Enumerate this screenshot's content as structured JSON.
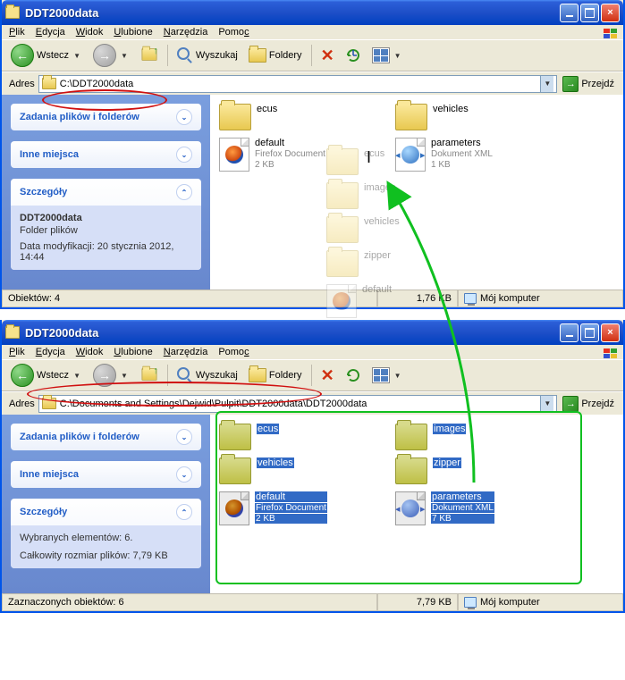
{
  "win1": {
    "title": "DDT2000data",
    "menu": [
      "Plik",
      "Edycja",
      "Widok",
      "Ulubione",
      "Narzędzia",
      "Pomoc"
    ],
    "tb": {
      "back": "Wstecz",
      "search": "Wyszukaj",
      "folders": "Foldery"
    },
    "addr_label": "Adres",
    "go": "Przejdź",
    "path": "C:\\DDT2000data",
    "tasks": "Zadania plików i folderów",
    "other": "Inne miejsca",
    "details": "Szczegóły",
    "det_name": "DDT2000data",
    "det_type": "Folder plików",
    "det_mod": "Data modyfikacji: 20 stycznia 2012, 14:44",
    "items": [
      {
        "name": "ecus",
        "type": "folder"
      },
      {
        "name": "vehicles",
        "type": "folder"
      },
      {
        "name": "default",
        "type": "ff",
        "sub1": "Firefox Document",
        "sub2": "2 KB"
      },
      {
        "name": "parameters",
        "type": "xml",
        "sub1": "Dokument XML",
        "sub2": "1 KB"
      }
    ],
    "status": {
      "objs": "Obiektów: 4",
      "size": "1,76 KB",
      "loc": "Mój komputer"
    }
  },
  "win2": {
    "title": "DDT2000data",
    "menu": [
      "Plik",
      "Edycja",
      "Widok",
      "Ulubione",
      "Narzędzia",
      "Pomoc"
    ],
    "tb": {
      "back": "Wstecz",
      "search": "Wyszukaj",
      "folders": "Foldery"
    },
    "addr_label": "Adres",
    "go": "Przejdź",
    "path": "C:\\Documents and Settings\\Dejwid\\Pulpit\\DDT2000data\\DDT2000data",
    "tasks": "Zadania plików i folderów",
    "other": "Inne miejsca",
    "details": "Szczegóły",
    "det_line1": "Wybranych elementów: 6.",
    "det_line2": "Całkowity rozmiar plików: 7,79 KB",
    "items": [
      {
        "name": "ecus",
        "type": "folder"
      },
      {
        "name": "images",
        "type": "folder"
      },
      {
        "name": "vehicles",
        "type": "folder"
      },
      {
        "name": "zipper",
        "type": "folder"
      },
      {
        "name": "default",
        "type": "ff",
        "sub1": "Firefox Document",
        "sub2": "2 KB"
      },
      {
        "name": "parameters",
        "type": "xml",
        "sub1": "Dokument XML",
        "sub2": "7 KB"
      }
    ],
    "status": {
      "objs": "Zaznaczonych obiektów: 6",
      "size": "7,79 KB",
      "loc": "Mój komputer"
    }
  }
}
